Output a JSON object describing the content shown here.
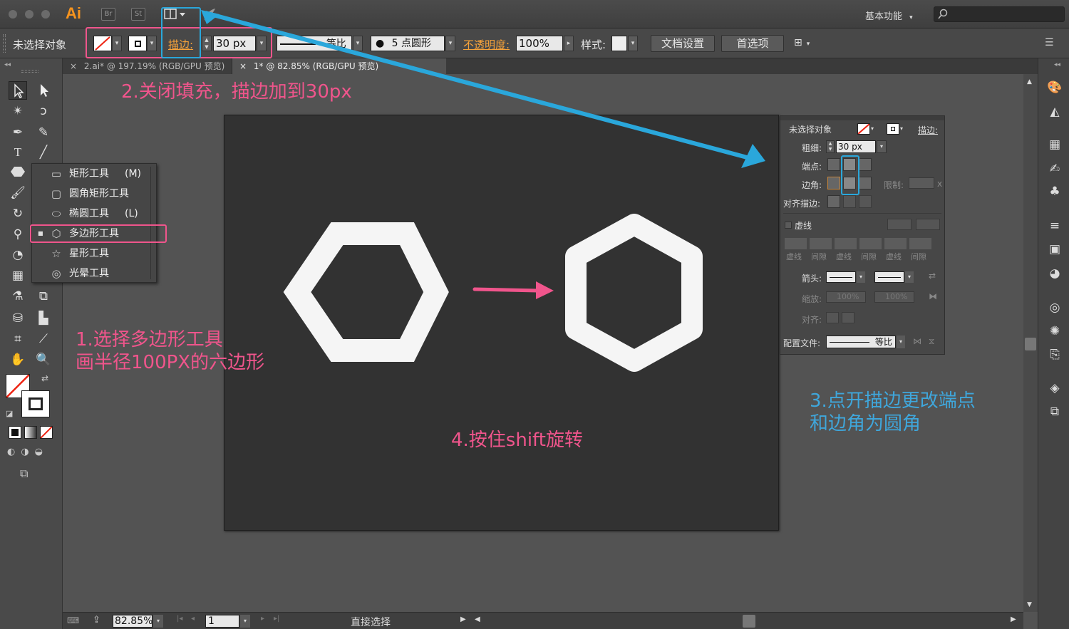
{
  "titlebar": {
    "app_logo": "Ai",
    "br_button": "Br",
    "st_button": "St",
    "workspace": "基本功能",
    "search_placeholder": ""
  },
  "controlbar": {
    "selection_status": "未选择对象",
    "stroke_label": "描边:",
    "stroke_weight": "30 px",
    "profile_label": "等比",
    "brush_label": "5 点圆形",
    "opacity_label": "不透明度:",
    "opacity_value": "100%",
    "style_label": "样式:",
    "doc_setup": "文档设置",
    "preferences": "首选项"
  },
  "tabs": [
    {
      "label": "2.ai* @ 197.19% (RGB/GPU 预览)"
    },
    {
      "label": "1* @ 82.85% (RGB/GPU 预览)"
    }
  ],
  "flyout": {
    "items": [
      {
        "label": "矩形工具",
        "shortcut": "(M)",
        "icon": "rectangle-icon"
      },
      {
        "label": "圆角矩形工具",
        "shortcut": "",
        "icon": "rounded-rectangle-icon"
      },
      {
        "label": "椭圆工具",
        "shortcut": "(L)",
        "icon": "ellipse-icon"
      },
      {
        "label": "多边形工具",
        "shortcut": "",
        "icon": "polygon-icon"
      },
      {
        "label": "星形工具",
        "shortcut": "",
        "icon": "star-icon"
      },
      {
        "label": "光晕工具",
        "shortcut": "",
        "icon": "flare-icon"
      }
    ]
  },
  "stroke_panel": {
    "header": "未选择对象",
    "stroke_tab": "描边:",
    "weight_label": "粗细:",
    "weight_value": "30 px",
    "cap_label": "端点:",
    "corner_label": "边角:",
    "limit_label": "限制:",
    "limit_suffix": "x",
    "align_label": "对齐描边:",
    "dashed_label": "虚线",
    "dash_labels": [
      "虚线",
      "间隙",
      "虚线",
      "间隙",
      "虚线",
      "间隙"
    ],
    "arrow_label": "箭头:",
    "scale_label": "缩放:",
    "scale_value_1": "100%",
    "scale_value_2": "100%",
    "align_arrow_label": "对齐:",
    "profile_label": "配置文件:",
    "profile_value": "等比"
  },
  "annotations": {
    "step1": "1.选择多边形工具\n画半径100PX的六边形",
    "step2": "2.关闭填充，描边加到30px",
    "step3": "3.点开描边更改端点\n和边角为圆角",
    "step4": "4.按住shift旋转"
  },
  "statusbar": {
    "zoom": "82.85%",
    "page": "1",
    "tool_status": "直接选择"
  },
  "colors": {
    "accent_orange": "#f7a33a",
    "annotation_pink": "#f0558c",
    "annotation_blue": "#2aa7db"
  }
}
